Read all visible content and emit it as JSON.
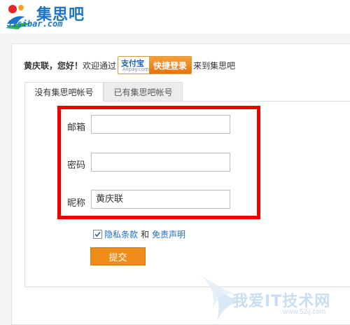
{
  "brand": {
    "name_cn": "集思吧",
    "name_en": "Jisibar.com"
  },
  "greeting": {
    "name": "黄庆联",
    "hello": "，您好！",
    "via": "欢迎通过",
    "suffix": "来到集思吧"
  },
  "alipay": {
    "logo_cn": "支付宝",
    "logo_en": "Alipay.com",
    "button_label": "快捷登录"
  },
  "tabs": [
    {
      "label": "没有集思吧帐号",
      "active": true
    },
    {
      "label": "已有集思吧帐号",
      "active": false
    }
  ],
  "form": {
    "email": {
      "label": "邮箱",
      "value": ""
    },
    "password": {
      "label": "密码",
      "value": ""
    },
    "nickname": {
      "label": "昵称",
      "value": "黄庆联"
    }
  },
  "agreement": {
    "checked": true,
    "privacy": "隐私条款",
    "and": "和",
    "disclaimer": "免责声明"
  },
  "submit_label": "提交",
  "watermark": {
    "text": "我爱IT技术网",
    "url": "www.52ij.com"
  },
  "colors": {
    "brand_blue": "#1a74c8",
    "highlight_red": "#ee0000",
    "submit_orange": "#f08c1a",
    "link_blue": "#1e6ec8"
  }
}
